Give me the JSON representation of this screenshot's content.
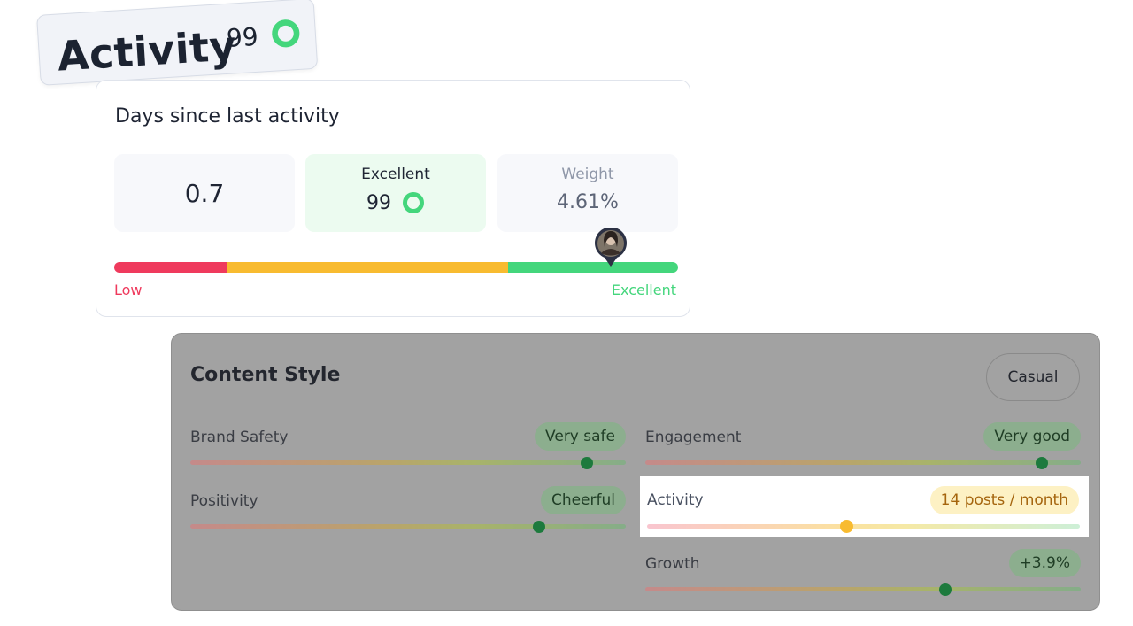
{
  "tag": {
    "title": "Activity",
    "score": "99",
    "score_ring_fraction": 0.99
  },
  "activity_card": {
    "title": "Days since last activity",
    "value": "0.7",
    "rating": {
      "label": "Excellent",
      "score": "99"
    },
    "weight": {
      "label": "Weight",
      "value": "4.61%"
    },
    "scale": {
      "low_label": "Low",
      "high_label": "Excellent",
      "marker_position": 0.88,
      "colors": {
        "low": "#ef3a5d",
        "mid": "#f8bb30",
        "high": "#44d67c"
      }
    }
  },
  "content_style": {
    "title": "Content Style",
    "style_button": "Casual",
    "metrics": [
      {
        "label": "Brand Safety",
        "badge": "Very safe",
        "level": 0.91
      },
      {
        "label": "Engagement",
        "badge": "Very good",
        "level": 0.91
      },
      {
        "label": "Positivity",
        "badge": "Cheerful",
        "level": 0.8
      },
      {
        "label": "Activity",
        "badge": "14 posts / month",
        "level": 0.46,
        "highlighted": true
      },
      {
        "label": "Growth",
        "badge": "+3.9%",
        "level": 0.69
      }
    ]
  },
  "colors": {
    "accent_green": "#44d67c",
    "accent_yellow": "#f8bb30",
    "accent_red": "#ef3a5d",
    "knob_green": "#1d7a3d"
  }
}
